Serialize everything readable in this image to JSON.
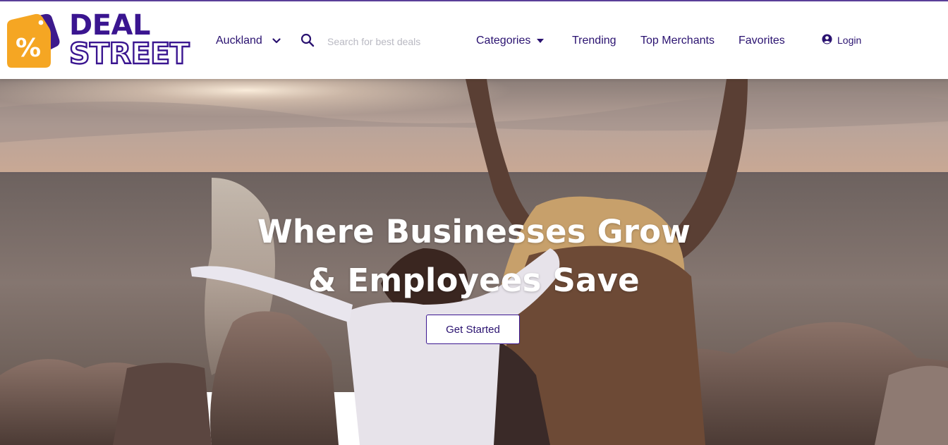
{
  "brand": {
    "line1": "DEAL",
    "line2": "STREET",
    "tag_symbol": "%",
    "colors": {
      "primary": "#3a1590",
      "tag_orange": "#f5a623",
      "tag_purple": "#3d1a8c"
    }
  },
  "nav": {
    "location": {
      "label": "Auckland",
      "icon": "chevron-down-icon"
    },
    "search": {
      "placeholder": "Search for best deals",
      "icon": "search-icon"
    },
    "categories": {
      "label": "Categories",
      "icon": "caret-down-icon"
    },
    "trending": "Trending",
    "top_merchants": "Top Merchants",
    "favorites": "Favorites",
    "login": {
      "label": "Login",
      "icon": "user-circle-icon"
    }
  },
  "hero": {
    "title_line1": "Where Businesses Grow",
    "title_line2": "& Employees Save",
    "cta_label": "Get Started",
    "background": "sunset-seaside-photo"
  }
}
